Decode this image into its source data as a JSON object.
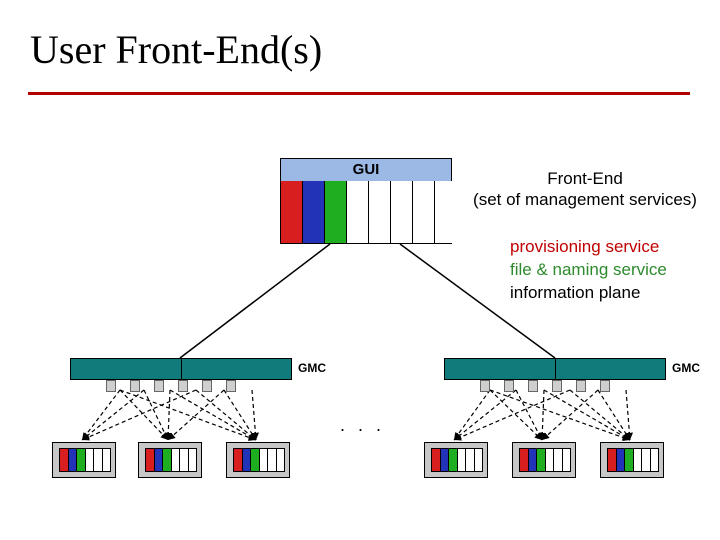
{
  "title": "User Front-End(s)",
  "gui": {
    "header": "GUI",
    "bars": [
      "red",
      "blue",
      "green",
      "white",
      "white",
      "white",
      "white",
      "white"
    ]
  },
  "frontend": {
    "label": "Front-End\n(set of management services)"
  },
  "services": {
    "provisioning": "provisioning service",
    "file_naming": "file & naming service",
    "information": "information plane"
  },
  "gmc_label": "GMC",
  "ellipsis": ".   .   .",
  "node_bars": [
    "red",
    "blue",
    "green",
    "white",
    "white",
    "white"
  ]
}
